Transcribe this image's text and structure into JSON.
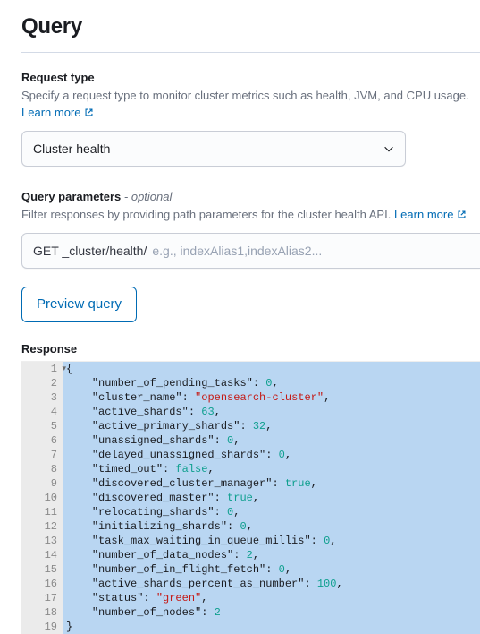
{
  "pageTitle": "Query",
  "requestType": {
    "label": "Request type",
    "help": "Specify a request type to monitor cluster metrics such as health, JVM, and CPU usage.",
    "learnMore": "Learn more",
    "selected": "Cluster health"
  },
  "queryParams": {
    "label": "Query parameters",
    "optional": "- optional",
    "help": "Filter responses by providing path parameters for the cluster health API.",
    "learnMore": "Learn more",
    "prefix": "GET _cluster/health/",
    "placeholder": "e.g., indexAlias1,indexAlias2..."
  },
  "previewBtn": "Preview query",
  "responseLabel": "Response",
  "responseBody": {
    "number_of_pending_tasks": 0,
    "cluster_name": "opensearch-cluster",
    "active_shards": 63,
    "active_primary_shards": 32,
    "unassigned_shards": 0,
    "delayed_unassigned_shards": 0,
    "timed_out": false,
    "discovered_cluster_manager": true,
    "discovered_master": true,
    "relocating_shards": 0,
    "initializing_shards": 0,
    "task_max_waiting_in_queue_millis": 0,
    "number_of_data_nodes": 2,
    "number_of_in_flight_fetch": 0,
    "active_shards_percent_as_number": 100,
    "status": "green",
    "number_of_nodes": 2
  }
}
